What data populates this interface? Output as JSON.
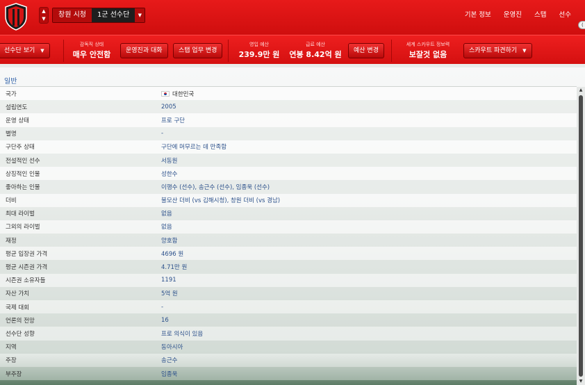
{
  "header": {
    "club_name": "창원 시청",
    "squad_name": "1군 선수단",
    "nav": [
      "기본 정보",
      "운영진",
      "스탭",
      "선수"
    ],
    "accent": "#e01515"
  },
  "toolbar": {
    "squad_view_label": "선수단 보기",
    "manager_status_label": "감독직 상태",
    "manager_status_value": "매우 안전함",
    "board_talk_label": "운영진과 대화",
    "staff_duty_label": "스탭 업무 변경",
    "wage_budget_label": "영입 예산",
    "wage_budget_value": "239.9만 원",
    "salary_budget_label": "급료 예산",
    "salary_budget_value": "연봉 8.42억 원",
    "budget_change_label": "예산 변경",
    "scout_report_label": "세계 스카우트 정보력",
    "scout_report_value": "보잘것 없음",
    "scout_dispatch_label": "스카우트 파견하기"
  },
  "section": {
    "title": "일반"
  },
  "info_rows": [
    {
      "key": "국가",
      "value": "대한민국"
    },
    {
      "key": "설립연도",
      "value": "2005"
    },
    {
      "key": "운영 상태",
      "value": "프로 구단"
    },
    {
      "key": "별명",
      "value": "-"
    },
    {
      "key": "구단주 상태",
      "value": "구단에 머무르는 데 만족함"
    },
    {
      "key": "전설적인 선수",
      "value": "서동원"
    },
    {
      "key": "상징적인 인물",
      "value": "성한수"
    },
    {
      "key": "좋아하는 인물",
      "value": "이행수 (선수), 송근수 (선수), 임종욱 (선수)"
    },
    {
      "key": "더비",
      "value": "불모산 더비 (vs 김해시청), 창원 더비 (vs 경남)"
    },
    {
      "key": "최대 라이벌",
      "value": "없음"
    },
    {
      "key": "그외의 라이벌",
      "value": "없음"
    },
    {
      "key": "재정",
      "value": "양호함"
    },
    {
      "key": "평균 입장권 가격",
      "value": "4696 원"
    },
    {
      "key": "평균 시즌권 가격",
      "value": "4.71만 원"
    },
    {
      "key": "시즌권 소유자들",
      "value": "1191"
    },
    {
      "key": "자산 가치",
      "value": "5억 원"
    },
    {
      "key": "국제 대회",
      "value": "-"
    },
    {
      "key": "언론의 전망",
      "value": "16"
    },
    {
      "key": "선수단 성향",
      "value": "프로 의식이 있음"
    },
    {
      "key": "지역",
      "value": "동아시아"
    },
    {
      "key": "주장",
      "value": "송근수"
    },
    {
      "key": "부주장",
      "value": "임종욱"
    }
  ]
}
